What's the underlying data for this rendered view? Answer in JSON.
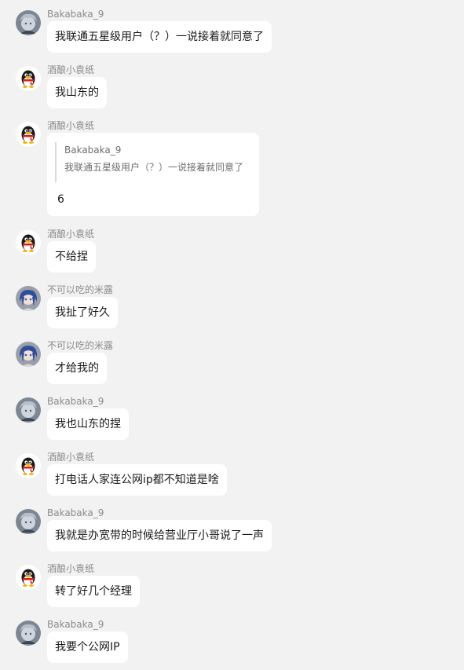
{
  "messages": [
    {
      "sender": "Bakabaka_9",
      "avatar": "anime-gray-avatar",
      "text": "我联通五星级用户（？）一说接着就同意了"
    },
    {
      "sender": "酒酿小袁纸",
      "avatar": "qq-penguin-avatar",
      "text": "我山东的"
    },
    {
      "sender": "酒酿小袁纸",
      "avatar": "qq-penguin-avatar",
      "quote": {
        "sender": "Bakabaka_9",
        "text": "我联通五星级用户（？）一说接着就同意了"
      },
      "text": "6"
    },
    {
      "sender": "酒酿小袁纸",
      "avatar": "qq-penguin-avatar",
      "text": "不给捏"
    },
    {
      "sender": "不可以吃的米露",
      "avatar": "anime-blue-hair-avatar",
      "text": "我扯了好久"
    },
    {
      "sender": "不可以吃的米露",
      "avatar": "anime-blue-hair-avatar",
      "text": "才给我的"
    },
    {
      "sender": "Bakabaka_9",
      "avatar": "anime-gray-avatar",
      "text": "我也山东的捏"
    },
    {
      "sender": "酒酿小袁纸",
      "avatar": "qq-penguin-avatar",
      "text": "打电话人家连公网ip都不知道是啥"
    },
    {
      "sender": "Bakabaka_9",
      "avatar": "anime-gray-avatar",
      "text": "我就是办宽带的时候给营业厅小哥说了一声"
    },
    {
      "sender": "酒酿小袁纸",
      "avatar": "qq-penguin-avatar",
      "text": "转了好几个经理"
    },
    {
      "sender": "Bakabaka_9",
      "avatar": "anime-gray-avatar",
      "text": "我要个公网IP"
    }
  ]
}
